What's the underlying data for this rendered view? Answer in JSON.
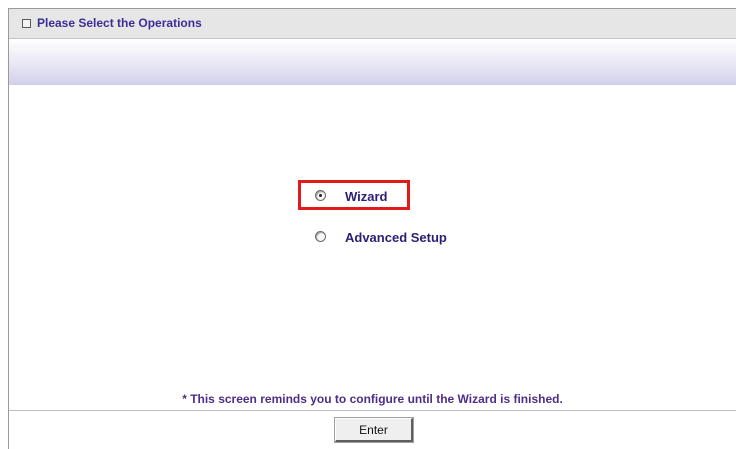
{
  "header": {
    "title": "Please Select the Operations",
    "icon": "square-bullet-icon",
    "title_color": "#3b2e97"
  },
  "options": {
    "selected": "wizard",
    "wizard": {
      "label": "Wizard",
      "checked": true,
      "highlight_color": "#e31a1a"
    },
    "advanced": {
      "label": "Advanced Setup",
      "checked": false
    }
  },
  "footer": {
    "reminder": "* This screen reminds you to configure until the Wizard is finished.",
    "enter_label": "Enter"
  }
}
